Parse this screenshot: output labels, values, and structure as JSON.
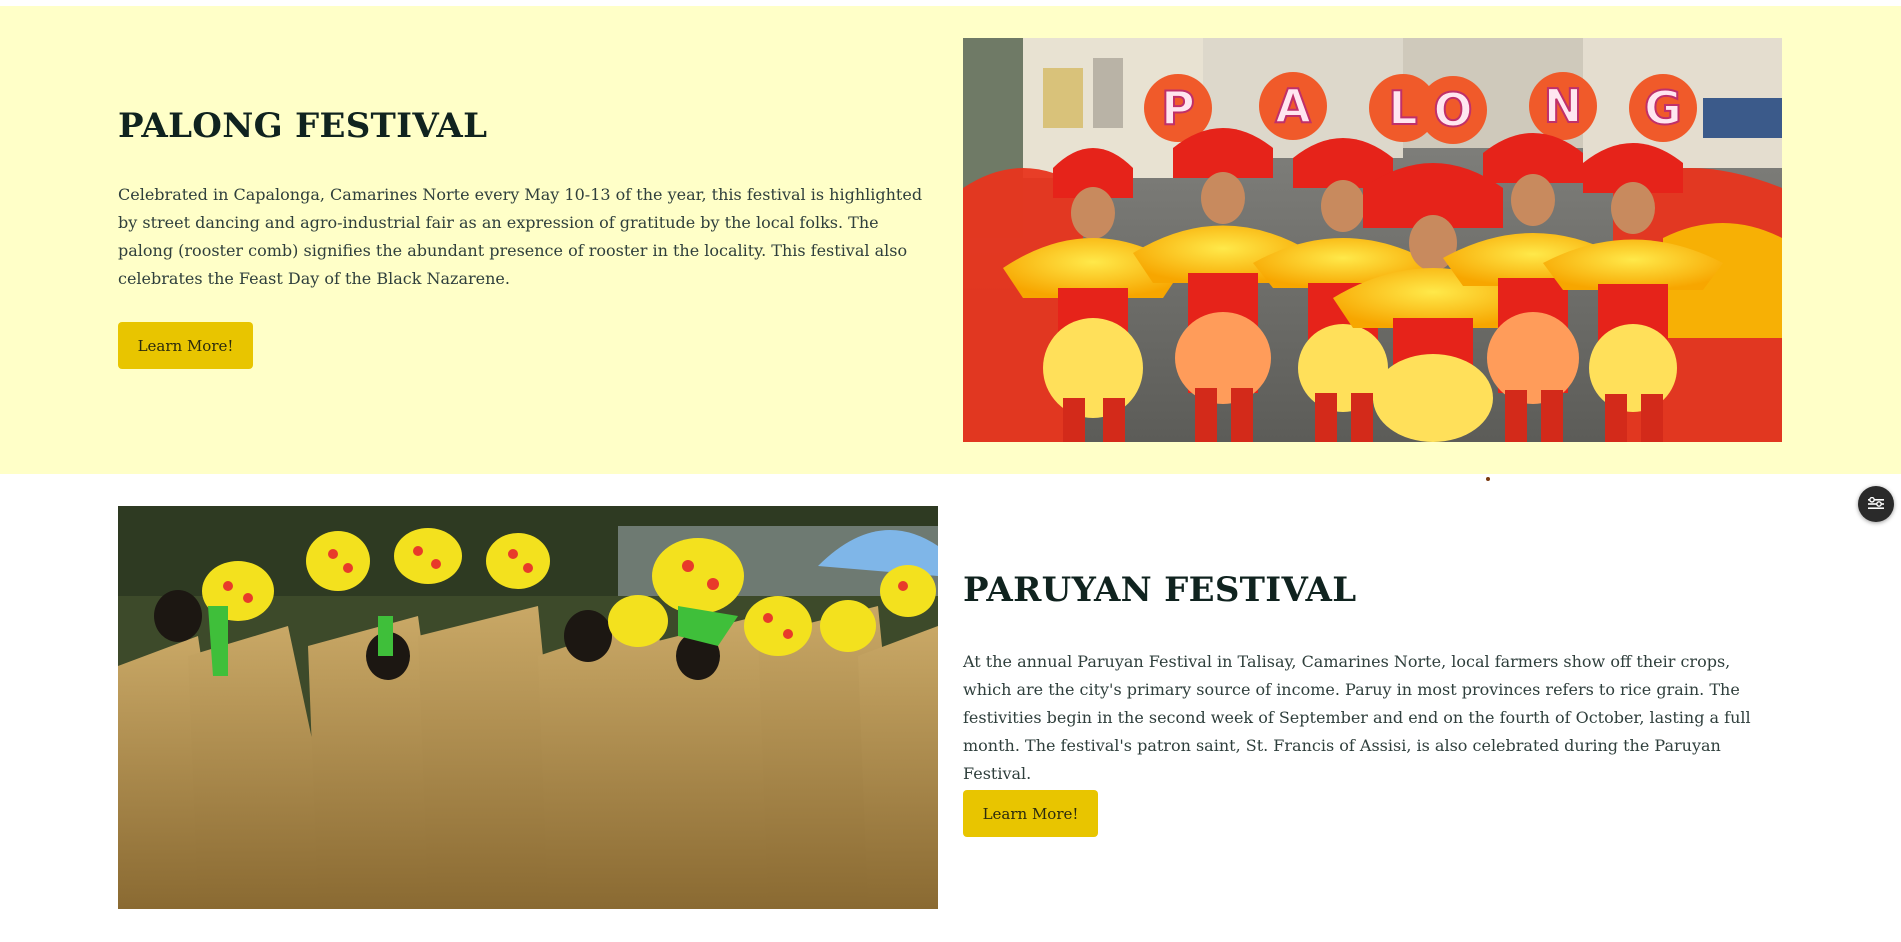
{
  "festivals": [
    {
      "title": "PALONG FESTIVAL",
      "description": "Celebrated in Capalonga, Camarines Norte every May 10-13 of the year, this festival is highlighted by street dancing and agro-industrial fair as an expression of gratitude by the local folks. The palong (rooster comb) signifies the abundant presence of rooster in the locality. This festival also celebrates the Feast Day of the Black Nazarene.",
      "button_label": "Learn More!",
      "image_alt": "Palong Festival dancers in red and yellow costumes",
      "image_sign_letters": [
        "P",
        "A",
        "L",
        "O",
        "N",
        "G"
      ]
    },
    {
      "title": "PARUYAN FESTIVAL",
      "description": "At the annual Paruyan Festival in Talisay, Camarines Norte, local farmers show off their crops, which are the city's primary source of income. Paruy in most provinces refers to rice grain. The festivities begin in the second week of September and end on the fourth of October, lasting a full month. The festival's patron saint, St. Francis of Assisi, is also celebrated during the Paruyan Festival.",
      "button_label": "Learn More!",
      "image_alt": "Paruyan Festival dancers in straw costumes with yellow hats"
    }
  ],
  "floating_button_icon": "sliders-icon",
  "colors": {
    "top_band_background": "#ffffc8",
    "button_background": "#e8c500",
    "title_color": "#10231f",
    "text_color": "#2f3f3c"
  }
}
